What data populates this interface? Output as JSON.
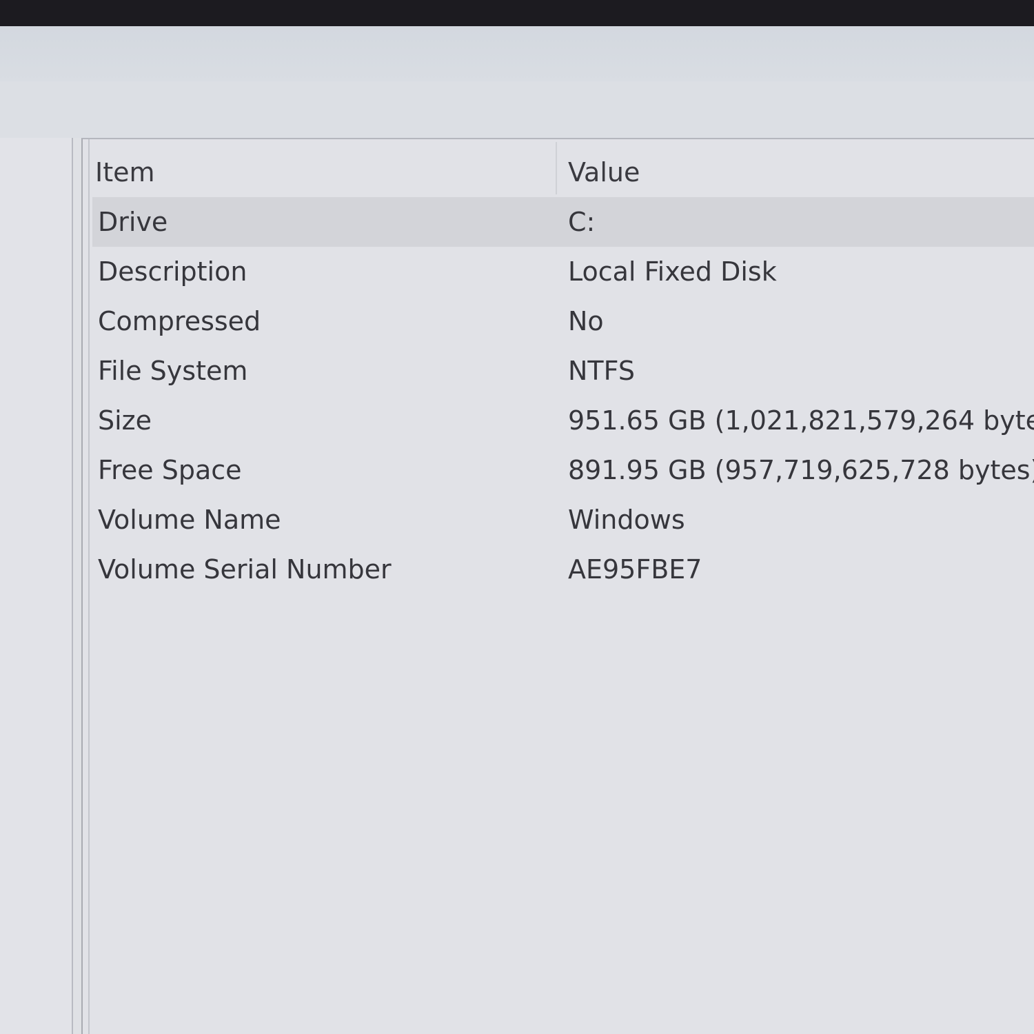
{
  "columns": {
    "item": "Item",
    "value": "Value"
  },
  "rows": [
    {
      "item": "Drive",
      "value": "C:",
      "selected": true
    },
    {
      "item": "Description",
      "value": "Local Fixed Disk"
    },
    {
      "item": "Compressed",
      "value": "No"
    },
    {
      "item": "File System",
      "value": "NTFS"
    },
    {
      "item": "Size",
      "value": "951.65 GB (1,021,821,579,264 byte"
    },
    {
      "item": "Free Space",
      "value": "891.95 GB (957,719,625,728 bytes)"
    },
    {
      "item": "Volume Name",
      "value": "Windows"
    },
    {
      "item": "Volume Serial Number",
      "value": "AE95FBE7"
    }
  ]
}
